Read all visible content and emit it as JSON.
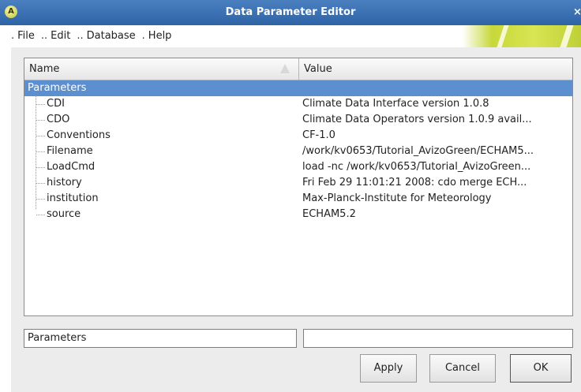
{
  "window": {
    "title": "Data Parameter Editor"
  },
  "menu": {
    "items": [
      "File",
      "Edit",
      "Database",
      "Help"
    ]
  },
  "tree": {
    "headers": {
      "name": "Name",
      "value": "Value"
    },
    "root": "Parameters",
    "rows": [
      {
        "name": "CDI",
        "value": "Climate Data Interface version 1.0.8"
      },
      {
        "name": "CDO",
        "value": "Climate Data Operators version 1.0.9 avail..."
      },
      {
        "name": "Conventions",
        "value": "CF-1.0"
      },
      {
        "name": "Filename",
        "value": "/work/kv0653/Tutorial_AvizoGreen/ECHAM5..."
      },
      {
        "name": "LoadCmd",
        "value": "load -nc /work/kv0653/Tutorial_AvizoGreen..."
      },
      {
        "name": "history",
        "value": "Fri Feb 29 11:01:21 2008: cdo merge ECH..."
      },
      {
        "name": "institution",
        "value": "Max-Planck-Institute for Meteorology"
      },
      {
        "name": "source",
        "value": "ECHAM5.2"
      }
    ]
  },
  "editor": {
    "name_field": "Parameters",
    "value_field": ""
  },
  "buttons": {
    "apply": "Apply",
    "cancel": "Cancel",
    "ok": "OK"
  },
  "colors": {
    "titlebar": "#3b73b6",
    "selection": "#5b8fd0",
    "brand": "#cfdc45"
  }
}
